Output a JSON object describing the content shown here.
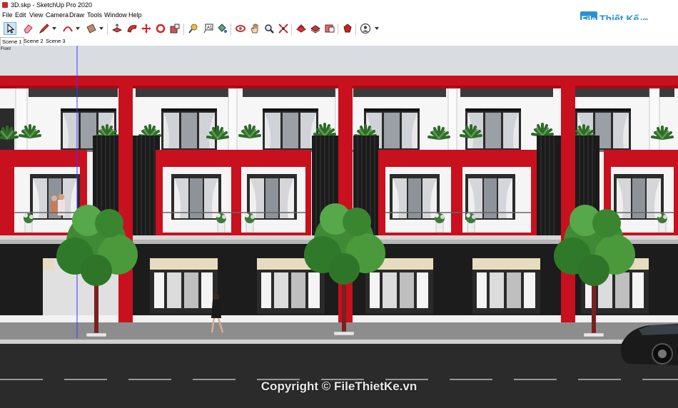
{
  "window": {
    "title": "3D.skp - SketchUp Pro 2020"
  },
  "menu": [
    "File",
    "Edit",
    "View",
    "Camera",
    "Draw",
    "Tools",
    "Window",
    "Help"
  ],
  "toolbar": {
    "tools": [
      "select-tool",
      "eraser-tool",
      "line-tool",
      "arc-tool",
      "shape-tool",
      "push-pull-tool",
      "follow-me-tool",
      "move-tool",
      "rotate-tool",
      "scale-tool",
      "tape-measure-tool",
      "text-tool",
      "paint-bucket-tool",
      "orbit-tool",
      "pan-tool",
      "zoom-tool",
      "zoom-extents-tool",
      "warehouse-tool",
      "extension-warehouse-tool",
      "layout-tool",
      "ruby-tool",
      "account-tool"
    ]
  },
  "scenes": [
    "Scene 1",
    "Scene 2",
    "Scene 3"
  ],
  "viewport": {
    "camera_label": "Front"
  },
  "watermark": {
    "logo_box": "File",
    "logo_text": "Thiết Kế",
    "logo_tld": ".vn",
    "copyright": "Copyright © FileThietKe.vn"
  },
  "colors": {
    "accent_red": "#c8101e",
    "facade_dark": "#1c1c1c",
    "road": "#2b2b2b",
    "logo_blue": "#2a8fd4"
  }
}
